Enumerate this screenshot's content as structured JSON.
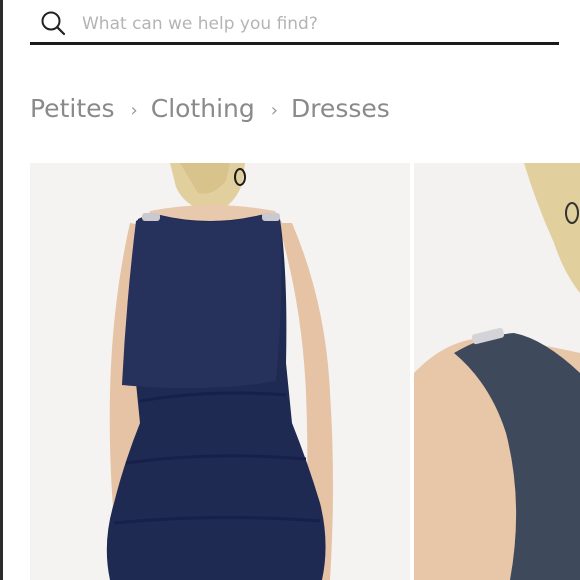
{
  "search": {
    "placeholder": "What can we help you find?",
    "icon": "search-icon"
  },
  "breadcrumb": {
    "items": [
      {
        "label": "Petites"
      },
      {
        "label": "Clothing"
      },
      {
        "label": "Dresses"
      }
    ],
    "separator": "›"
  },
  "gallery": {
    "images": [
      {
        "subject": "navy tiered sleeveless dress, back view"
      },
      {
        "subject": "navy dress shoulder detail with embellished strap"
      }
    ]
  },
  "colors": {
    "dress": "#1f2a52",
    "dress_side": "#3e4a5c",
    "search_underline": "#1a1a1a",
    "breadcrumb_text": "#8a8a8a"
  }
}
